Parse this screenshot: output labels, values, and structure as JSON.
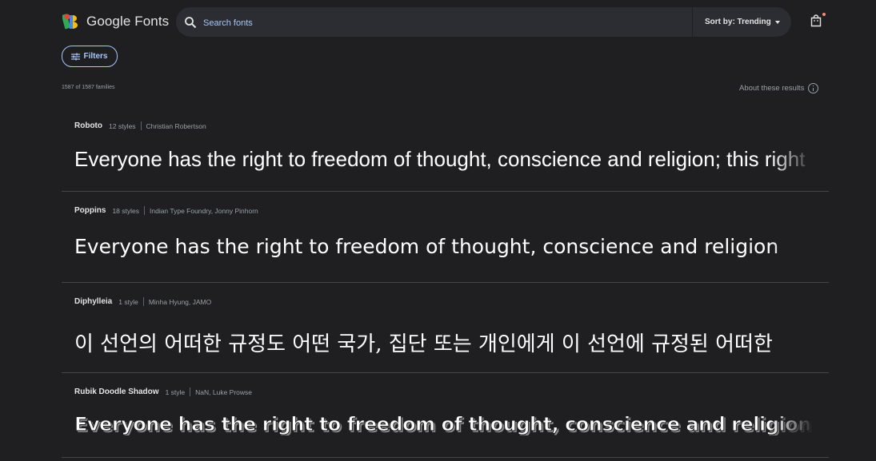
{
  "header": {
    "brand": "Google Fonts",
    "search_placeholder": "Search fonts",
    "sort_label": "Sort by: Trending"
  },
  "toolbar": {
    "filters_label": "Filters",
    "results_count": "1587 of 1587 families",
    "about_label": "About these results"
  },
  "fonts": [
    {
      "name": "Roboto",
      "styles": "12 styles",
      "designer": "Christian Robertson",
      "preview": "Everyone has the right to freedom of thought, conscience and religion; this right"
    },
    {
      "name": "Poppins",
      "styles": "18 styles",
      "designer": "Indian Type Foundry, Jonny Pinhorn",
      "preview": "Everyone has the right to freedom of thought, conscience and religion"
    },
    {
      "name": "Diphylleia",
      "styles": "1 style",
      "designer": "Minha Hyung, JAMO",
      "preview": "이 선언의 어떠한 규정도 어떤 국가, 집단 또는 개인에게 이 선언에 규정된 어떠한"
    },
    {
      "name": "Rubik Doodle Shadow",
      "styles": "1 style",
      "designer": "NaN, Luke Prowse",
      "preview": "Everyone has the right to freedom of thought, conscience and religion"
    }
  ],
  "colors": {
    "background": "#1f1f21",
    "accent": "#a8c7fa",
    "notification_dot": "#f28b82"
  }
}
